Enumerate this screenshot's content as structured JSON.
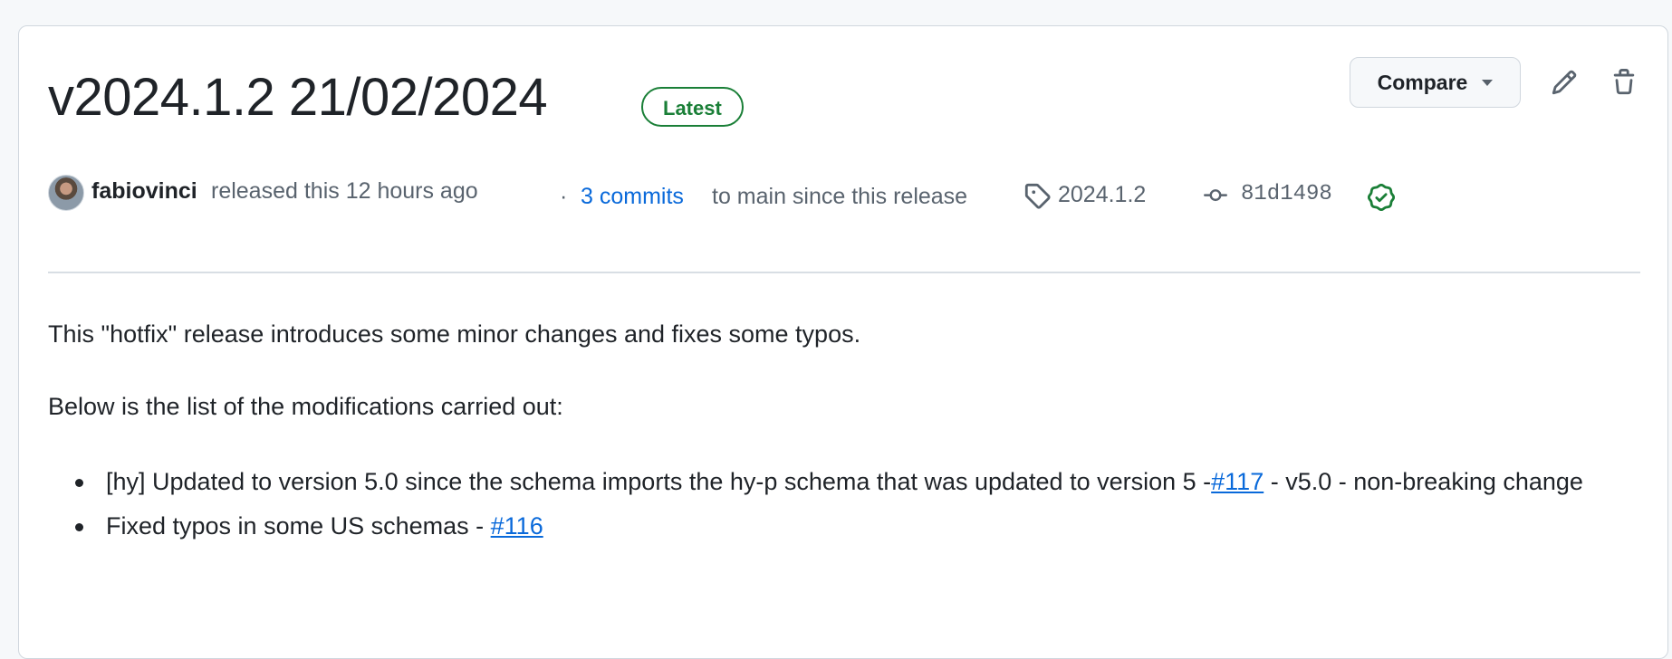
{
  "release": {
    "title": "v2024.1.2 21/02/2024",
    "badge": "Latest",
    "compare_label": "Compare",
    "author": "fabiovinci",
    "released_text": "released this 12 hours ago",
    "commits_prefix": "·",
    "commits_link": "3 commits",
    "commits_suffix": "to main since this release",
    "tag": "2024.1.2",
    "commit_sha": "81d1498"
  },
  "body": {
    "paragraph1": "This \"hotfix\" release introduces some minor changes and fixes some typos.",
    "paragraph2": "Below is the list of the modifications carried out:",
    "items": [
      {
        "text_before": "[hy] Updated to version 5.0 since the schema imports the hy-p schema that was updated to version 5 -",
        "link": "#117",
        "text_after": " - v5.0 - non-breaking change"
      },
      {
        "text_before": "Fixed typos in some US schemas - ",
        "link": "#116",
        "text_after": ""
      }
    ]
  },
  "colors": {
    "accent_link": "#0969da",
    "badge_green": "#1a7f37",
    "border": "#d0d7de"
  },
  "icons": [
    "pencil-icon",
    "trash-icon",
    "tag-icon",
    "git-commit-icon",
    "verified-check-icon",
    "caret-down-icon"
  ]
}
